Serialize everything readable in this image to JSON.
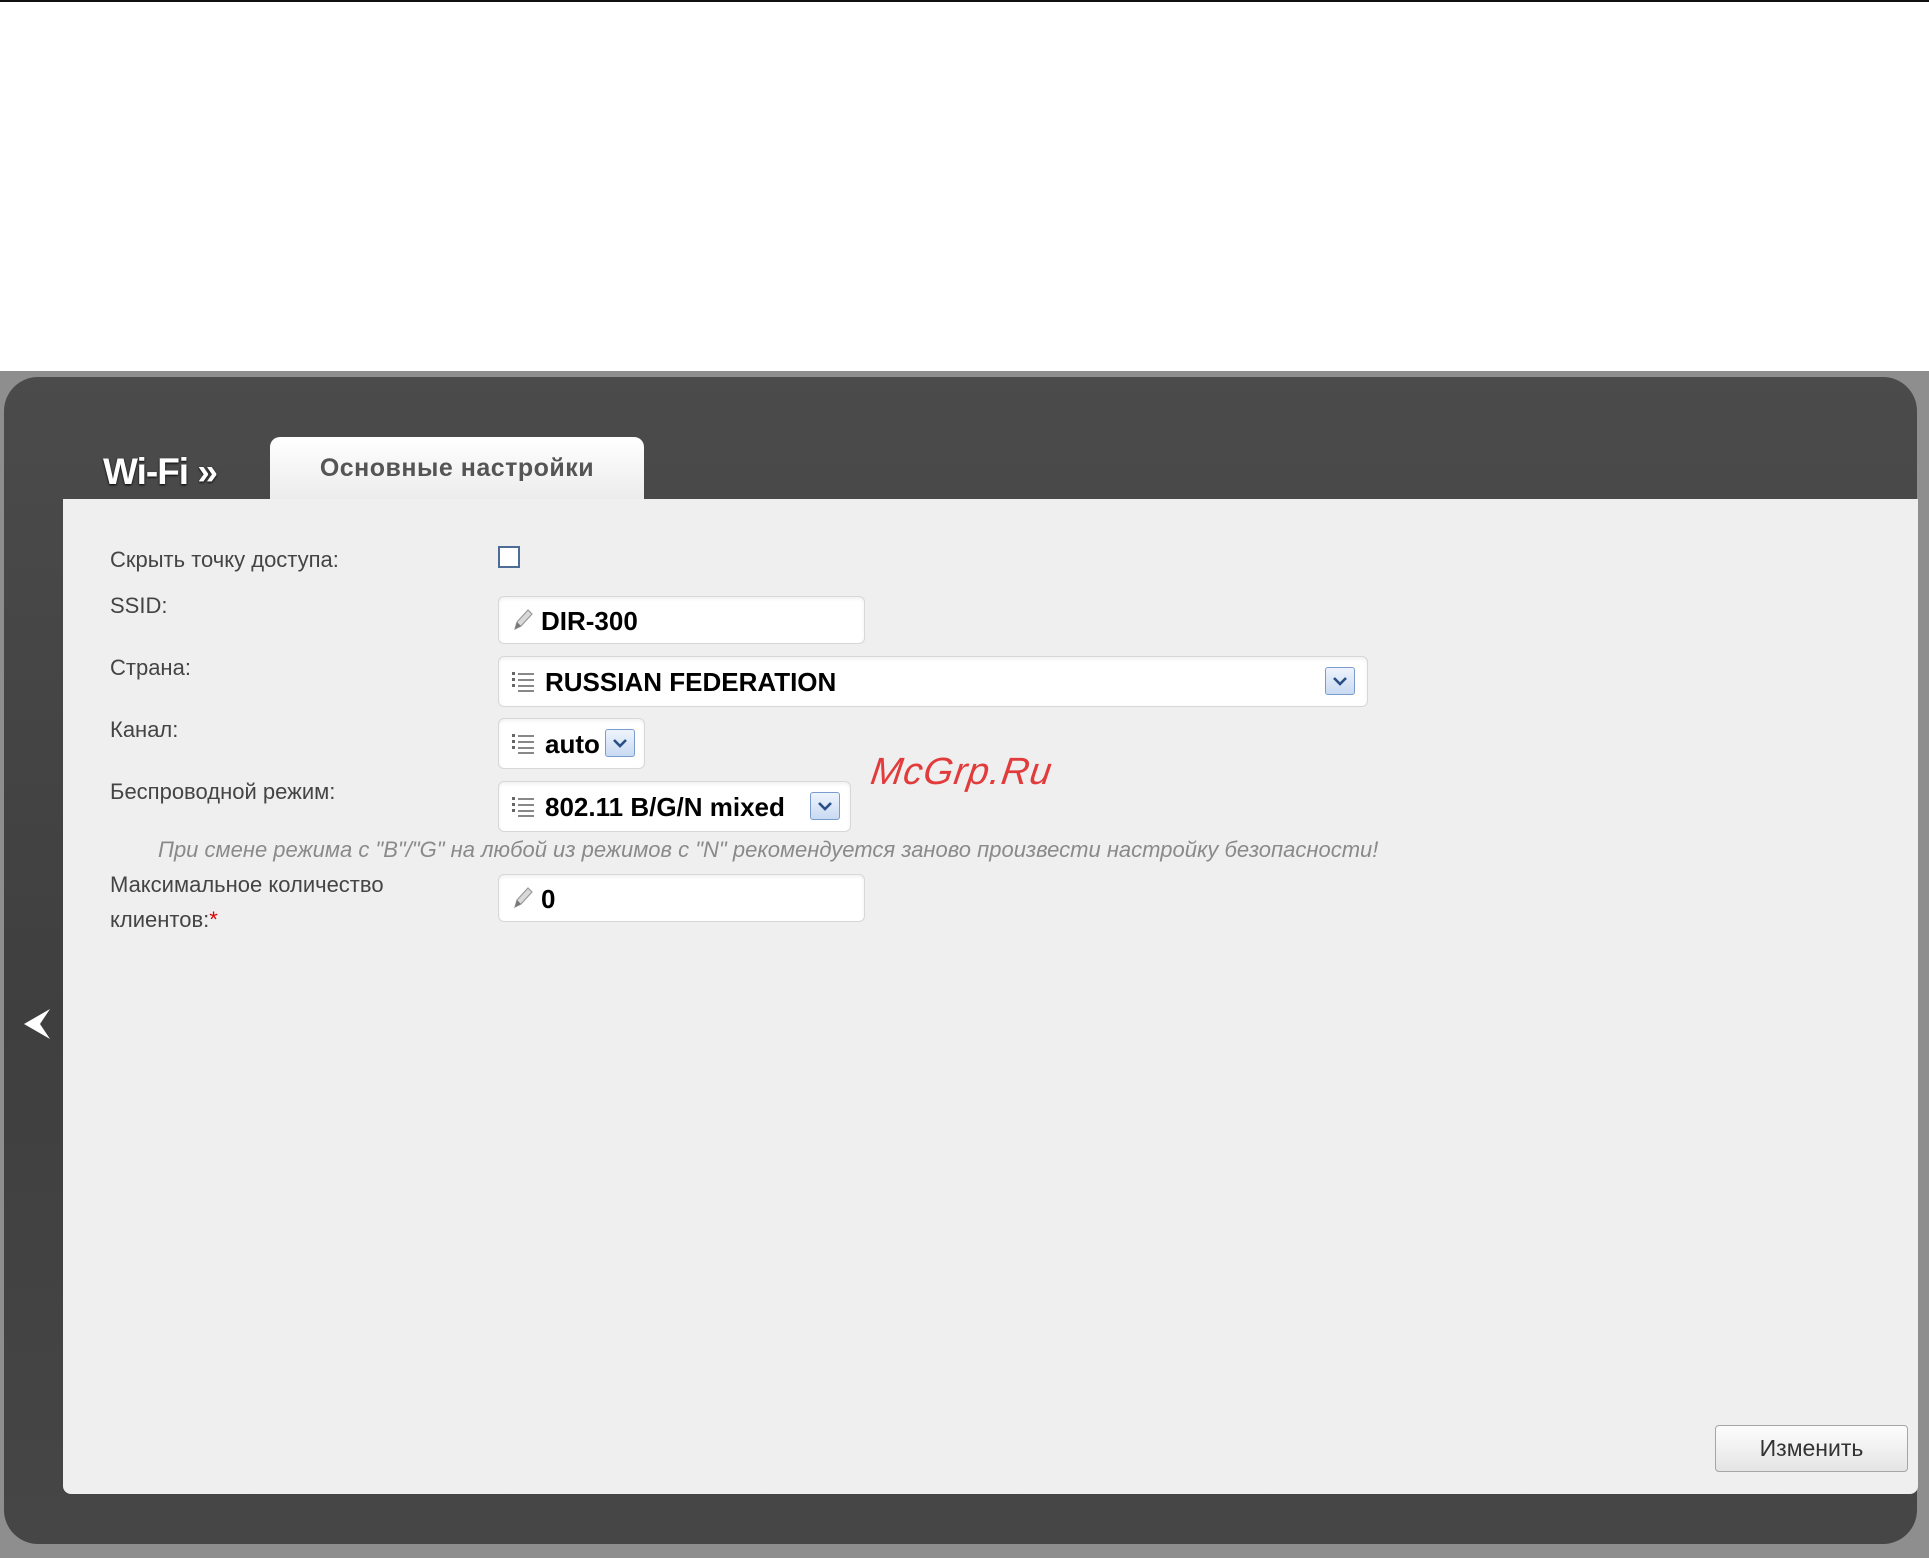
{
  "header": {
    "section_title": "Wi-Fi »",
    "active_tab": "Основные настройки"
  },
  "form": {
    "hide_ap": {
      "label": "Скрыть точку доступа:",
      "checked": false
    },
    "ssid": {
      "label": "SSID:",
      "value": "DIR-300"
    },
    "country": {
      "label": "Страна:",
      "value": "RUSSIAN FEDERATION"
    },
    "channel": {
      "label": "Канал:",
      "value": "auto"
    },
    "wireless_mode": {
      "label": "Беспроводной режим:",
      "value": "802.11 B/G/N mixed"
    },
    "mode_hint": "При смене режима с \"B\"/\"G\" на любой из режимов с \"N\" рекомендуется заново произвести настройку безопасности!",
    "max_clients": {
      "label_line1": "Максимальное количество",
      "label_line2": "клиентов:",
      "required_mark": "*",
      "value": "0"
    }
  },
  "buttons": {
    "apply_label": "Изменить"
  },
  "watermark": "McGrp.Ru",
  "icons": {
    "back": "chevron-left-icon",
    "edit": "pencil-icon",
    "list": "list-icon",
    "dropdown": "chevron-down-icon"
  }
}
